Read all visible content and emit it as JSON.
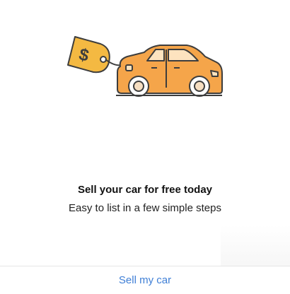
{
  "hero": {
    "illustration": "car-with-price-tag-illustration",
    "tag_symbol": "$",
    "colors": {
      "body": "#f5a54a",
      "tag": "#f4b942",
      "outline": "#3d3d3d",
      "window": "#fde3bf",
      "wheel": "#f6dec1"
    }
  },
  "content": {
    "title": "Sell your car for free today",
    "subtitle": "Easy to list in a few simple steps"
  },
  "footer": {
    "sell_label": "Sell my car",
    "link_color": "#3f7fd6"
  }
}
